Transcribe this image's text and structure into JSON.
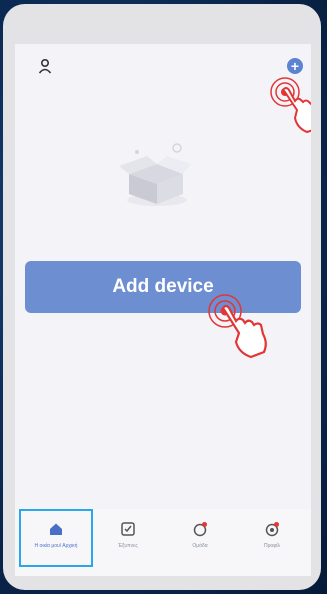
{
  "app": {
    "add_device_label": "Add device",
    "accent_color": "#6d8ed1",
    "highlight_color": "#2aa6ea"
  },
  "icons": {
    "profile": "person-icon",
    "add": "plus-circle-icon",
    "empty_state": "empty-box-illustration",
    "tap_hint": "tap-hand-icon"
  },
  "bottom_nav": {
    "items": [
      {
        "label": "Η οικία μου/ Αρχική",
        "icon": "home-icon",
        "active": true
      },
      {
        "label": "Έξυπνες",
        "icon": "checklist-icon",
        "active": false
      },
      {
        "label": "Ομάδα",
        "icon": "group-icon",
        "active": false
      },
      {
        "label": "Προφίλ",
        "icon": "profile-icon",
        "active": false
      }
    ]
  }
}
